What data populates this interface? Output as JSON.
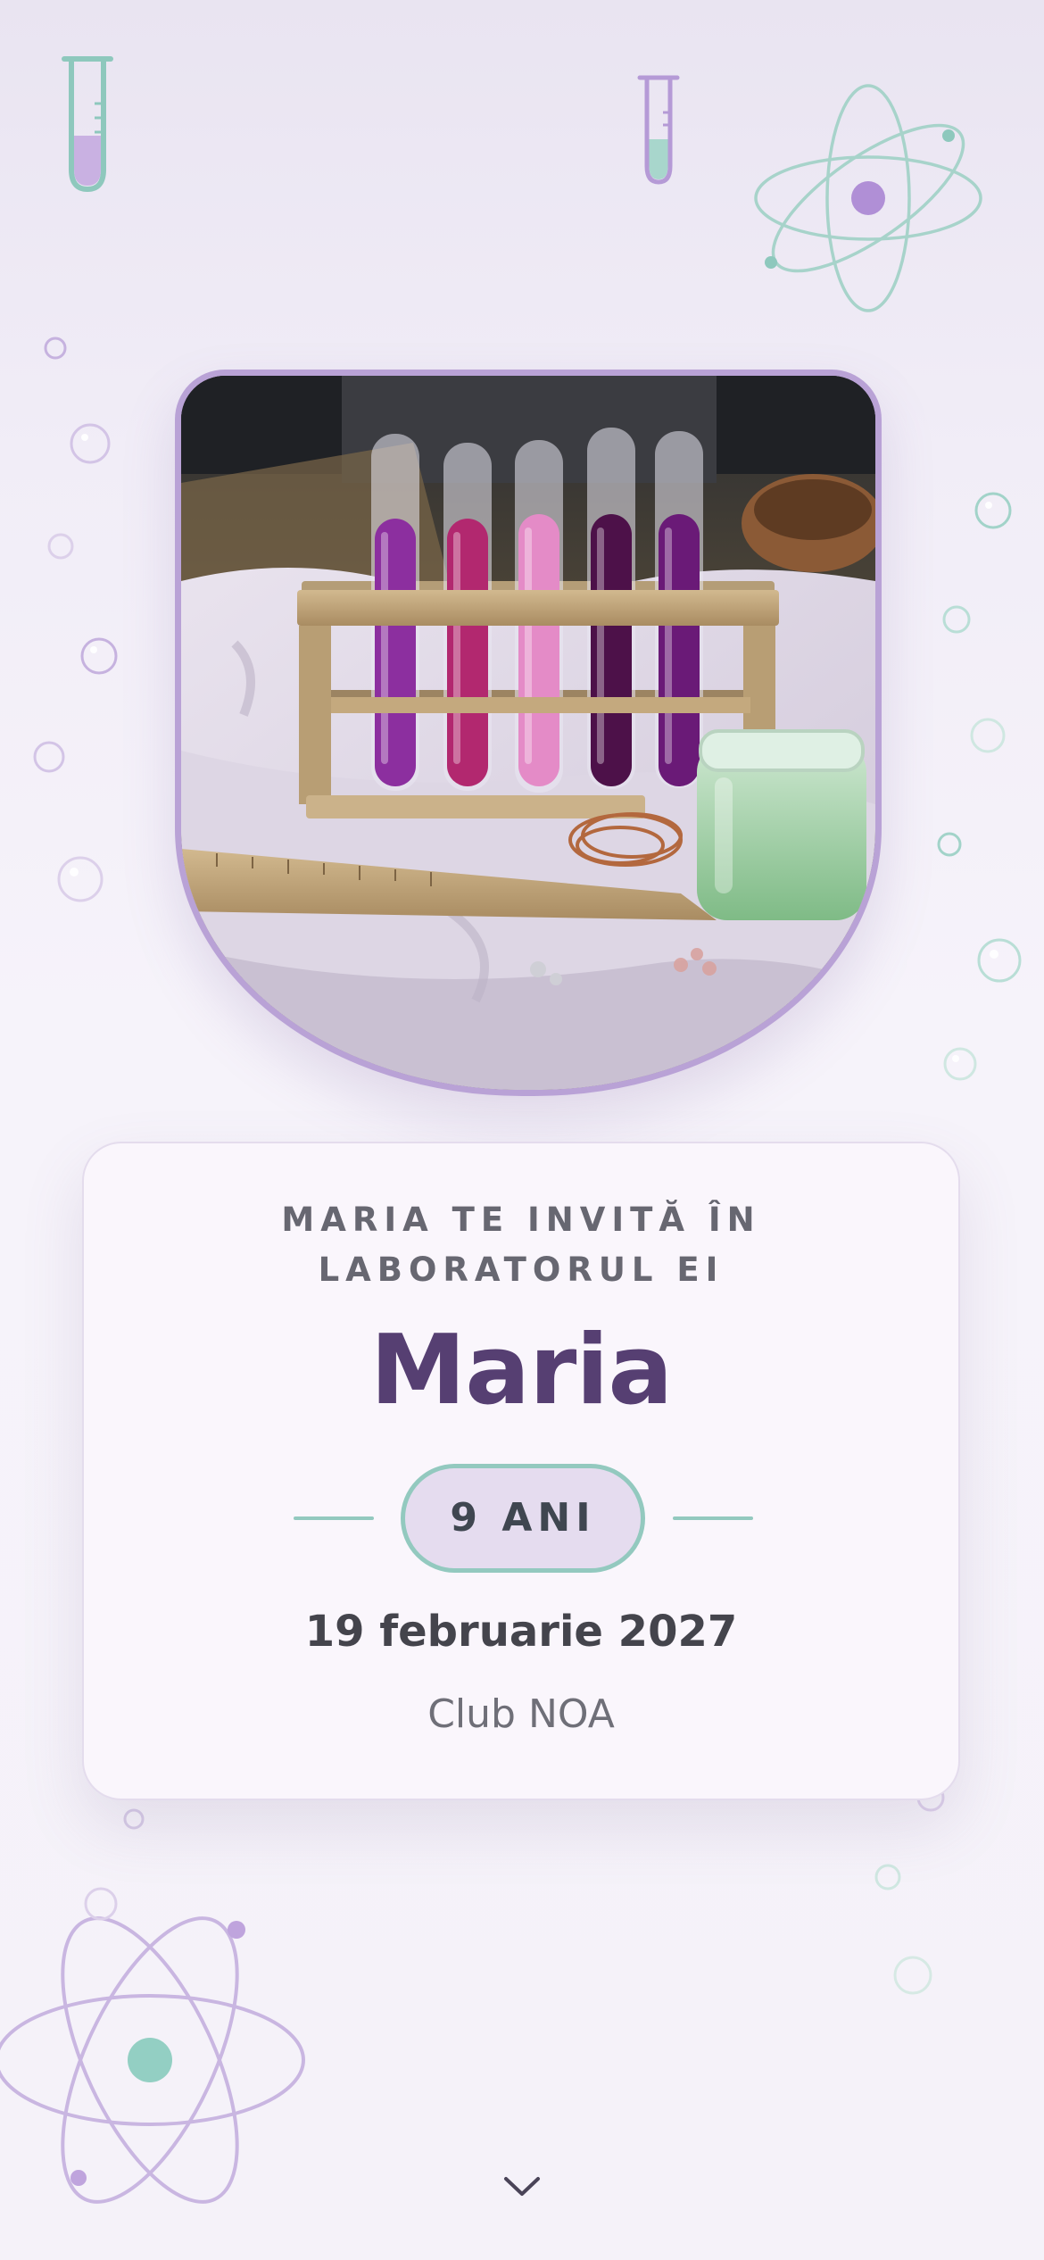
{
  "invitation": {
    "intro_line_1": "MARIA TE INVITĂ ÎN",
    "intro_line_2": "LABORATORUL EI",
    "name": "Maria",
    "age_label": "9 ANI",
    "date": "19 februarie 2027",
    "venue": "Club NOA"
  },
  "icons": {
    "scroll": "chevron-down-icon",
    "decorations": [
      "test-tube-icon",
      "test-tube-icon",
      "atom-icon",
      "atom-icon",
      "bubble-icon"
    ]
  },
  "colors": {
    "purple_accent": "#b9a2d6",
    "teal_accent": "#93c9bf",
    "name_color": "#563f72",
    "pill_fill": "#e5dcef",
    "card_bg": "#faf6fc"
  }
}
